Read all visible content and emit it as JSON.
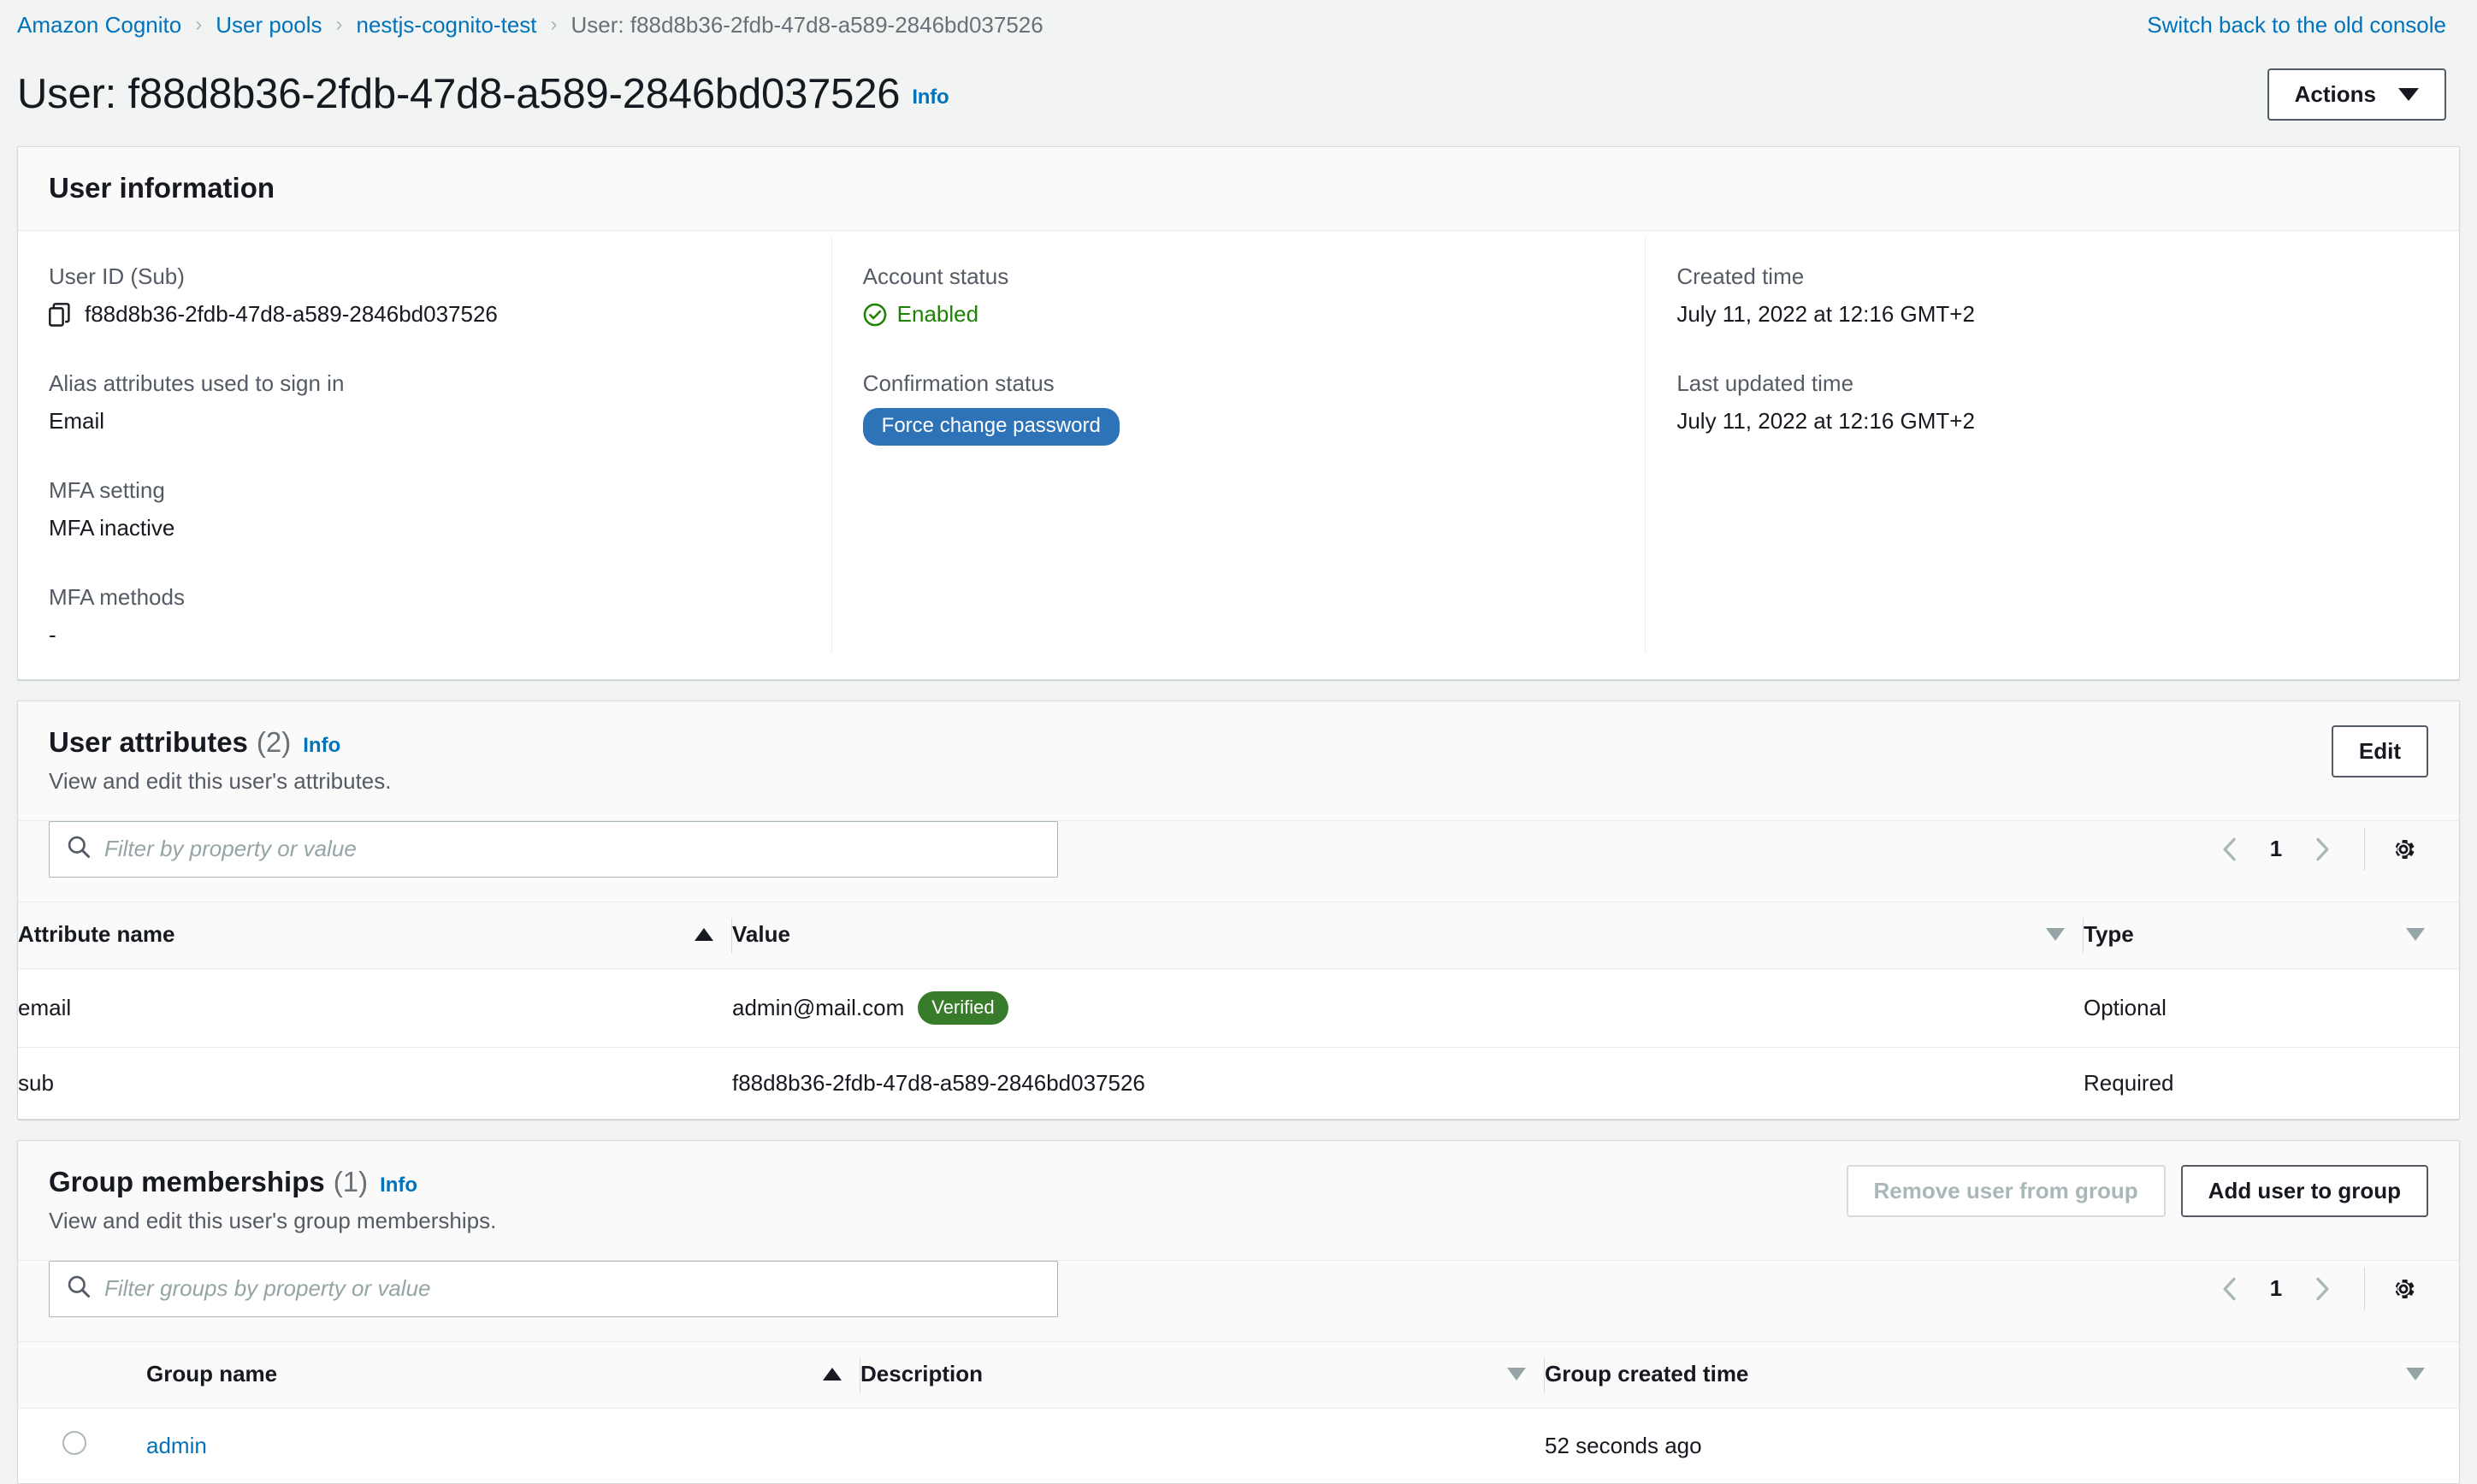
{
  "breadcrumb": {
    "items": [
      {
        "label": "Amazon Cognito",
        "current": false
      },
      {
        "label": "User pools",
        "current": false
      },
      {
        "label": "nestjs-cognito-test",
        "current": false
      },
      {
        "label": "User: f88d8b36-2fdb-47d8-a589-2846bd037526",
        "current": true
      }
    ],
    "separator": "›"
  },
  "topbar": {
    "old_console_link": "Switch back to the old console"
  },
  "page": {
    "title": "User: f88d8b36-2fdb-47d8-a589-2846bd037526",
    "info_label": "Info",
    "actions_button": "Actions"
  },
  "user_information": {
    "title": "User information",
    "left": {
      "user_id_label": "User ID (Sub)",
      "user_id_value": "f88d8b36-2fdb-47d8-a589-2846bd037526",
      "alias_label": "Alias attributes used to sign in",
      "alias_value": "Email",
      "mfa_setting_label": "MFA setting",
      "mfa_setting_value": "MFA inactive",
      "mfa_methods_label": "MFA methods",
      "mfa_methods_value": "-"
    },
    "middle": {
      "account_status_label": "Account status",
      "account_status_value": "Enabled",
      "confirmation_status_label": "Confirmation status",
      "confirmation_status_value": "Force change password"
    },
    "right": {
      "created_time_label": "Created time",
      "created_time_value": "July 11, 2022 at 12:16 GMT+2",
      "last_updated_label": "Last updated time",
      "last_updated_value": "July 11, 2022 at 12:16 GMT+2"
    }
  },
  "user_attributes": {
    "title": "User attributes",
    "count": "(2)",
    "info_label": "Info",
    "description": "View and edit this user's attributes.",
    "edit_button": "Edit",
    "filter_placeholder": "Filter by property or value",
    "filter_value": "",
    "page_number": "1",
    "columns": [
      {
        "label": "Attribute name",
        "sort": "asc"
      },
      {
        "label": "Value",
        "sort": "none"
      },
      {
        "label": "Type",
        "sort": "none"
      }
    ],
    "rows": [
      {
        "name": "email",
        "value": "admin@mail.com",
        "badge": "Verified",
        "type": "Optional"
      },
      {
        "name": "sub",
        "value": "f88d8b36-2fdb-47d8-a589-2846bd037526",
        "badge": "",
        "type": "Required"
      }
    ]
  },
  "group_memberships": {
    "title": "Group memberships",
    "count": "(1)",
    "info_label": "Info",
    "description": "View and edit this user's group memberships.",
    "remove_button": "Remove user from group",
    "add_button": "Add user to group",
    "filter_placeholder": "Filter groups by property or value",
    "filter_value": "",
    "page_number": "1",
    "columns": [
      {
        "label": "Group name",
        "sort": "asc"
      },
      {
        "label": "Description",
        "sort": "none"
      },
      {
        "label": "Group created time",
        "sort": "none"
      }
    ],
    "rows": [
      {
        "name": "admin",
        "description": "",
        "created": "52 seconds ago"
      }
    ]
  },
  "colors": {
    "link": "#0073bb",
    "success": "#1d8102",
    "badge_blue": "#2e72b8",
    "badge_green": "#387c2b",
    "page_bg": "#f2f3f3"
  },
  "icons": {
    "copy": "copy-icon",
    "search": "search-icon",
    "gear": "gear-icon",
    "check_circle": "check-circle-icon"
  }
}
